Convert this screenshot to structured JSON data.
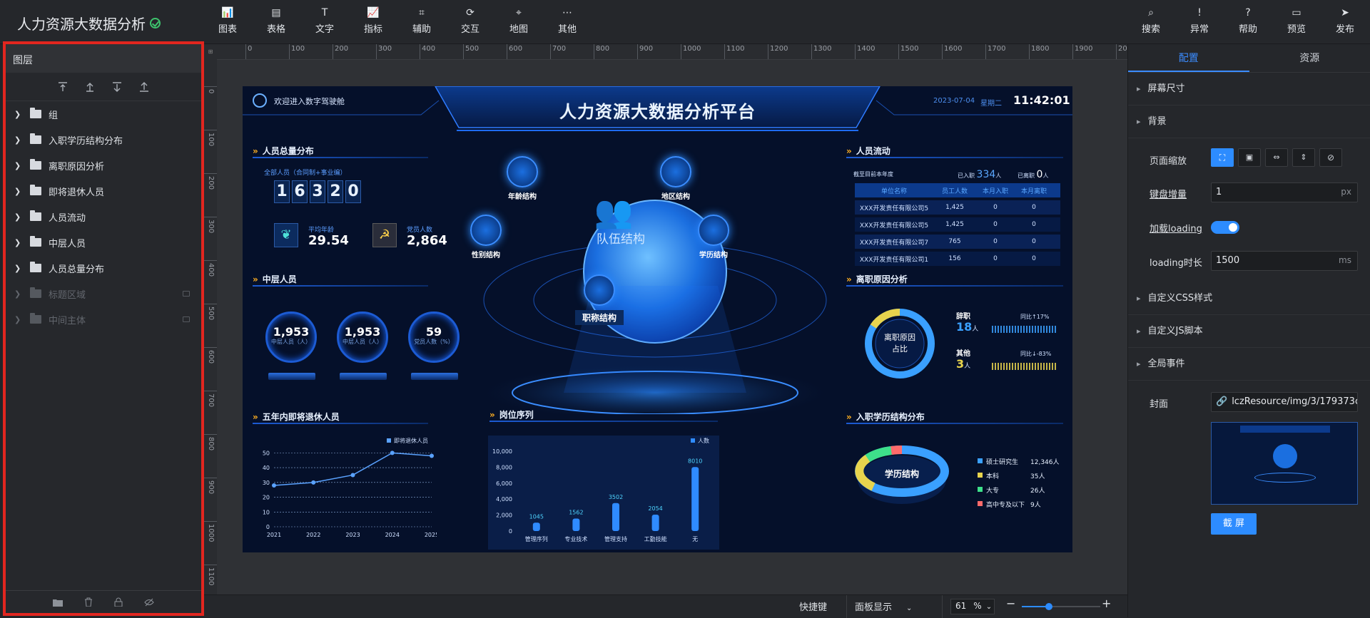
{
  "app": {
    "title": "人力资源大数据分析"
  },
  "toolbar": {
    "left": [
      {
        "label": "图表",
        "icon": "chart-icon"
      },
      {
        "label": "表格",
        "icon": "table-icon"
      },
      {
        "label": "文字",
        "icon": "text-icon"
      },
      {
        "label": "指标",
        "icon": "indicator-icon"
      },
      {
        "label": "辅助",
        "icon": "auxiliary-icon"
      },
      {
        "label": "交互",
        "icon": "interaction-icon"
      },
      {
        "label": "地图",
        "icon": "map-icon"
      },
      {
        "label": "其他",
        "icon": "more-icon"
      }
    ],
    "right": [
      {
        "label": "搜索",
        "icon": "search-icon"
      },
      {
        "label": "异常",
        "icon": "alert-icon"
      },
      {
        "label": "帮助",
        "icon": "help-icon"
      },
      {
        "label": "预览",
        "icon": "preview-icon"
      },
      {
        "label": "发布",
        "icon": "publish-icon"
      }
    ]
  },
  "layers": {
    "title": "图层",
    "items": [
      {
        "label": "组",
        "locked": false
      },
      {
        "label": "入职学历结构分布",
        "locked": false
      },
      {
        "label": "离职原因分析",
        "locked": false
      },
      {
        "label": "即将退休人员",
        "locked": false
      },
      {
        "label": "人员流动",
        "locked": false
      },
      {
        "label": "中层人员",
        "locked": false
      },
      {
        "label": "人员总量分布",
        "locked": false
      },
      {
        "label": "标题区域",
        "locked": true
      },
      {
        "label": "中间主体",
        "locked": true
      }
    ]
  },
  "ruler": {
    "h": [
      "0",
      "100",
      "200",
      "300",
      "400",
      "500",
      "600",
      "700",
      "800",
      "900",
      "1000",
      "1100",
      "1200",
      "1300",
      "1400",
      "1500",
      "1600",
      "1700",
      "1800",
      "1900",
      "2000"
    ],
    "v": [
      "0",
      "100",
      "200",
      "300",
      "400",
      "500",
      "600",
      "700",
      "800",
      "900",
      "1000",
      "1100"
    ]
  },
  "screen": {
    "welcome": "欢迎进入数字驾驶舱",
    "title": "人力资源大数据分析平台",
    "date": "2023-07-04",
    "weekday": "星期二",
    "time": "11:42:01",
    "total": {
      "title": "人员总量分布",
      "subtitle": "全部人员（合同制+事业编）",
      "digits": [
        "1",
        "6",
        "3",
        "2",
        "0"
      ],
      "avg_age_label": "平均年龄",
      "avg_age": "29.54",
      "party_label": "党员人数",
      "party": "2,864"
    },
    "middle": {
      "title": "中层人员",
      "gauges": [
        {
          "value": "1,953",
          "label": "中层人员（人）"
        },
        {
          "value": "1,953",
          "label": "中层人员（人）"
        },
        {
          "value": "59",
          "label": "党员人数（%）"
        }
      ]
    },
    "center": {
      "orb_label": "队伍结构",
      "nodes": [
        "年龄结构",
        "地区结构",
        "性别结构",
        "学历结构",
        "职称结构"
      ]
    },
    "flow": {
      "title": "人员流动",
      "period": "截至目前本年度",
      "in_label": "已入职",
      "in_value": "334",
      "in_unit": "人",
      "out_label": "已离职",
      "out_value": "0",
      "out_unit": "人",
      "headers": [
        "单位名称",
        "员工人数",
        "本月入职",
        "本月离职"
      ],
      "rows": [
        [
          "XXX开发责任有限公司5",
          "1,425",
          "0",
          "0"
        ],
        [
          "XXX开发责任有限公司5",
          "1,425",
          "0",
          "0"
        ],
        [
          "XXX开发责任有限公司7",
          "765",
          "0",
          "0"
        ],
        [
          "XXX开发责任有限公司1",
          "156",
          "0",
          "0"
        ]
      ]
    },
    "leave": {
      "title": "离职原因分析",
      "ring_label_1": "离职原因",
      "ring_label_2": "占比",
      "items": [
        {
          "name": "辞职",
          "value": "18",
          "unit": "人",
          "cmp": "同比↑17%",
          "color": "#3aa0ff"
        },
        {
          "name": "其他",
          "value": "3",
          "unit": "人",
          "cmp": "同比↓-83%",
          "color": "#e8d44d"
        }
      ]
    },
    "retire_title": "五年内即将退休人员",
    "post_title": "岗位序列",
    "edu": {
      "title": "入职学历结构分布",
      "ring": "学历结构",
      "legend": [
        {
          "name": "硕士研究生",
          "value": "12,346人",
          "color": "#3aa0ff"
        },
        {
          "name": "本科",
          "value": "35人",
          "color": "#e8d44d"
        },
        {
          "name": "大专",
          "value": "26人",
          "color": "#3ee08a"
        },
        {
          "name": "高中专及以下",
          "value": "9人",
          "color": "#ff6b6b"
        }
      ]
    }
  },
  "chart_data": [
    {
      "type": "line",
      "title": "五年内即将退休人员",
      "series": [
        {
          "name": "即将退休人员",
          "values": [
            28,
            30,
            35,
            50,
            48
          ]
        }
      ],
      "x": [
        "2021",
        "2022",
        "2023",
        "2024",
        "2025"
      ],
      "yticks": [
        "0",
        "10",
        "20",
        "30",
        "40",
        "50"
      ],
      "ylim": [
        0,
        55
      ],
      "color": "#5aa2ff",
      "grid": true
    },
    {
      "type": "bar",
      "title": "岗位序列",
      "series": [
        {
          "name": "人数",
          "values": [
            1045,
            1562,
            3502,
            2054,
            8010
          ]
        }
      ],
      "categories": [
        "管理序列",
        "专业技术",
        "管理支持",
        "工勤技能",
        "无"
      ],
      "yticks": [
        "0",
        "2,000",
        "4,000",
        "6,000",
        "8,000",
        "10,000"
      ],
      "ylim": [
        0,
        10000
      ],
      "color": "#2f8bff"
    }
  ],
  "config": {
    "tabs": [
      "配置",
      "资源"
    ],
    "sections": [
      "屏幕尺寸",
      "背景"
    ],
    "zoom_label": "页面缩放",
    "step_label": "键盘增量",
    "step_value": "1",
    "step_unit": "px",
    "loading_label": "加载loading",
    "loading_on": true,
    "loading_time_label": "loading时长",
    "loading_time": "1500",
    "loading_time_unit": "ms",
    "sections2": [
      "自定义CSS样式",
      "自定义JS脚本",
      "全局事件"
    ],
    "cover_label": "封面",
    "cover_path": "lczResource/img/3/179373c7",
    "capture_button": "截 屏"
  },
  "footer": {
    "shortcut": "快捷键",
    "panel_display": "面板显示",
    "zoom": "61",
    "zoom_unit": "%"
  }
}
